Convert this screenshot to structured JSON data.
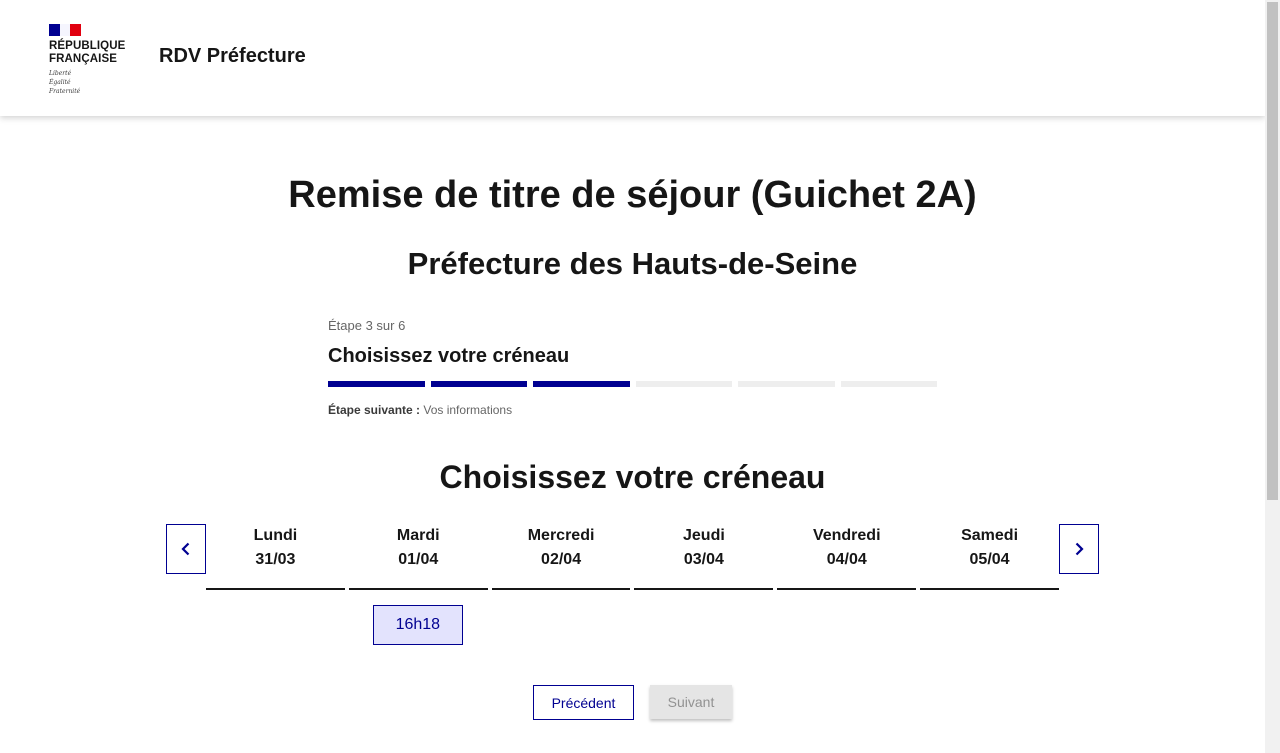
{
  "header": {
    "logo": {
      "name": "RÉPUBLIQUE\nFRANÇAISE",
      "motto": "Liberté\nÉgalité\nFraternité"
    },
    "site_title": "RDV Préfecture"
  },
  "page": {
    "title": "Remise de titre de séjour (Guichet 2A)",
    "subtitle": "Préfecture des Hauts-de-Seine"
  },
  "stepper": {
    "state": "Étape 3 sur 6",
    "current_title": "Choisissez votre créneau",
    "current_step": 3,
    "total_steps": 6,
    "next_label": "Étape suivante :",
    "next_value": " Vos informations"
  },
  "calendar": {
    "heading": "Choisissez votre créneau",
    "prev_icon": "chevron-left-icon",
    "next_icon": "chevron-right-icon",
    "days": [
      {
        "weekday": "Lundi",
        "date": "31/03",
        "slots": []
      },
      {
        "weekday": "Mardi",
        "date": "01/04",
        "slots": [
          "16h18"
        ]
      },
      {
        "weekday": "Mercredi",
        "date": "02/04",
        "slots": []
      },
      {
        "weekday": "Jeudi",
        "date": "03/04",
        "slots": []
      },
      {
        "weekday": "Vendredi",
        "date": "04/04",
        "slots": []
      },
      {
        "weekday": "Samedi",
        "date": "05/04",
        "slots": []
      }
    ]
  },
  "actions": {
    "previous": "Précédent",
    "next": "Suivant"
  },
  "colors": {
    "primary": "#000091",
    "slot_bg": "#e3e3fd",
    "disabled_bg": "#e5e5e5",
    "disabled_text": "#929292"
  }
}
